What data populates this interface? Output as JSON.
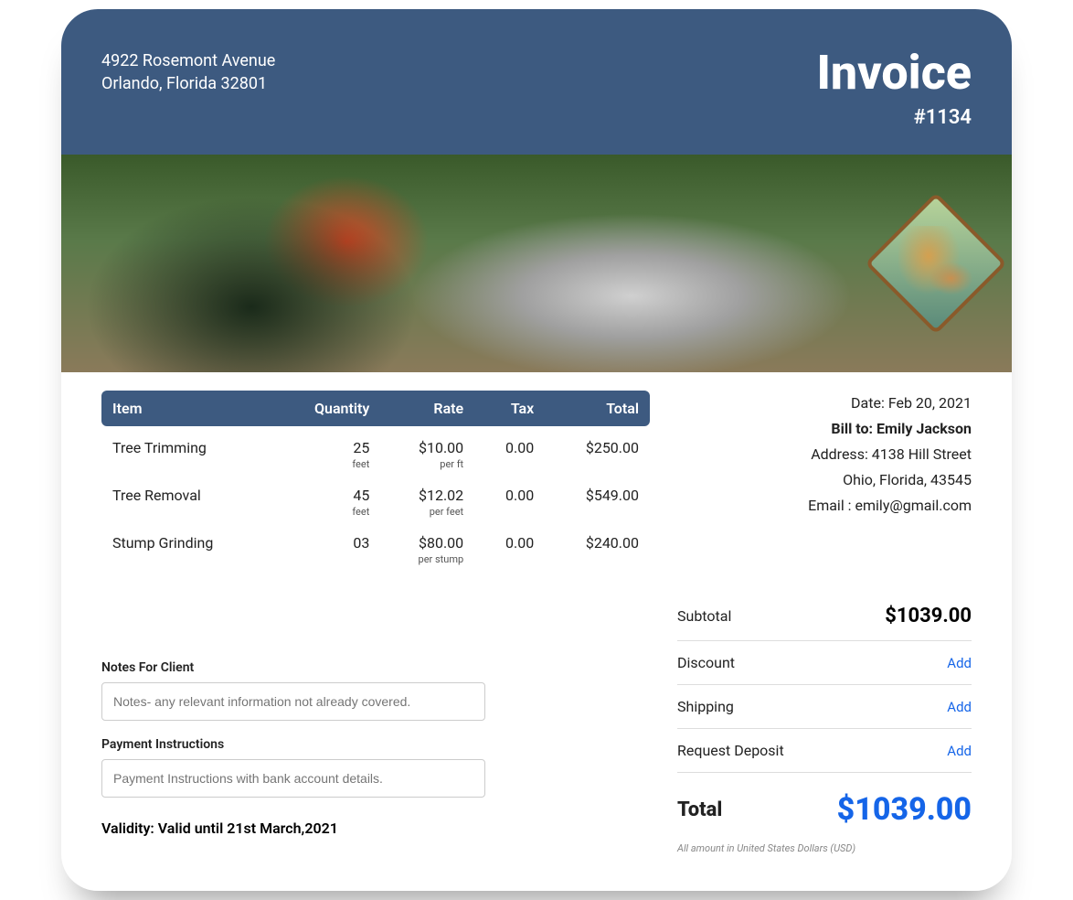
{
  "header": {
    "address_line1": "4922 Rosemont Avenue",
    "address_line2": "Orlando, Florida 32801",
    "title": "Invoice",
    "number": "#1134"
  },
  "bill": {
    "date_label": "Date: ",
    "date": "Feb 20, 2021",
    "bill_to_label": "Bill to: ",
    "bill_to_name": "Emily Jackson",
    "address_label": "Address: ",
    "address_line1": "4138 Hill Street",
    "address_line2": "Ohio, Florida, 43545",
    "email_label": "Email : ",
    "email": "emily@gmail.com"
  },
  "table": {
    "headers": {
      "item": "Item",
      "quantity": "Quantity",
      "rate": "Rate",
      "tax": "Tax",
      "total": "Total"
    }
  },
  "items": [
    {
      "name": "Tree Trimming",
      "qty": "25",
      "qty_unit": "feet",
      "rate": "$10.00",
      "rate_unit": "per ft",
      "tax": "0.00",
      "total": "$250.00"
    },
    {
      "name": "Tree Removal",
      "qty": "45",
      "qty_unit": "feet",
      "rate": "$12.02",
      "rate_unit": "per feet",
      "tax": "0.00",
      "total": "$549.00"
    },
    {
      "name": "Stump Grinding",
      "qty": "03",
      "qty_unit": "",
      "rate": "$80.00",
      "rate_unit": "per stump",
      "tax": "0.00",
      "total": "$240.00"
    }
  ],
  "notes": {
    "notes_label": "Notes For Client",
    "notes_placeholder": "Notes- any relevant information not already covered.",
    "payment_label": "Payment Instructions",
    "payment_placeholder": "Payment Instructions with bank account details.",
    "validity_label": "Validity: ",
    "validity_value": "Valid until 21st March,2021"
  },
  "totals": {
    "subtotal_label": "Subtotal",
    "subtotal_value": "$1039.00",
    "discount_label": "Discount",
    "shipping_label": "Shipping",
    "deposit_label": "Request Deposit",
    "add_label": "Add",
    "total_label": "Total",
    "total_value": "$1039.00",
    "currency_note": "All amount in United States Dollars (USD)"
  }
}
